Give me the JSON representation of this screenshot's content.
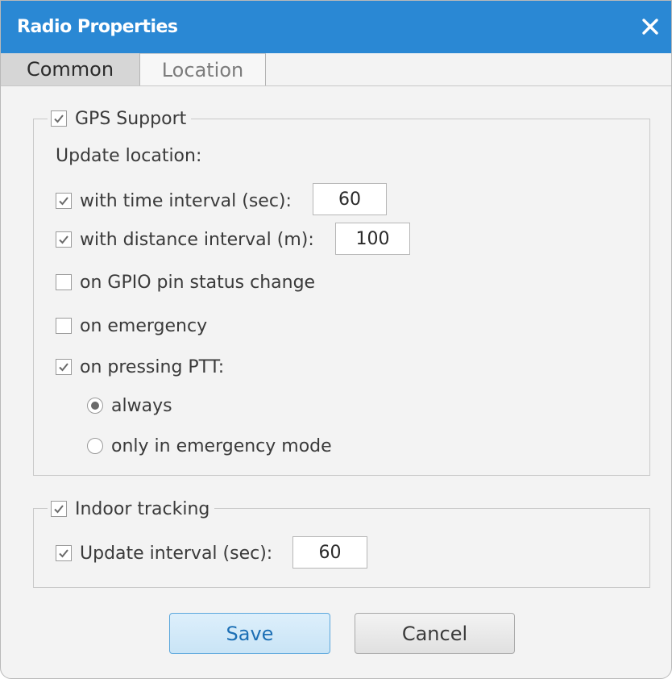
{
  "window": {
    "title": "Radio Properties",
    "accent_color": "#2a88d4",
    "close_icon": "close-icon"
  },
  "tabs": [
    {
      "label": "Common",
      "selected": true
    },
    {
      "label": "Location",
      "selected": false
    }
  ],
  "gps_group": {
    "legend_label": "GPS Support",
    "legend_checked": true,
    "update_location_label": "Update location:",
    "time_interval": {
      "label": "with time interval (sec):",
      "checked": true,
      "value": "60"
    },
    "distance_interval": {
      "label": "with distance interval (m):",
      "checked": true,
      "value": "100"
    },
    "gpio_change": {
      "label": "on GPIO pin status change",
      "checked": false
    },
    "emergency": {
      "label": "on emergency",
      "checked": false
    },
    "pressing_ptt": {
      "label": "on pressing PTT:",
      "checked": true
    },
    "ptt_options": [
      {
        "label": "always",
        "selected": true
      },
      {
        "label": "only in emergency mode",
        "selected": false
      }
    ]
  },
  "indoor_group": {
    "legend_label": "Indoor tracking",
    "legend_checked": true,
    "update_interval": {
      "label": "Update interval (sec):",
      "checked": true,
      "value": "60"
    }
  },
  "buttons": {
    "save_label": "Save",
    "cancel_label": "Cancel"
  }
}
